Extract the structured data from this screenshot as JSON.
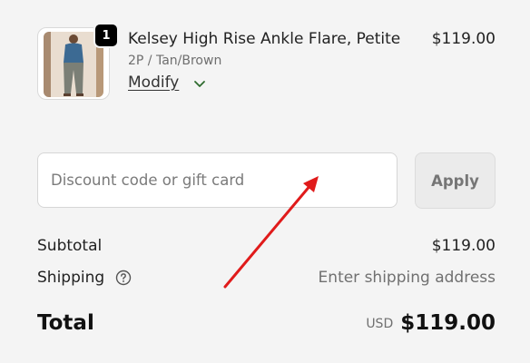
{
  "line_item": {
    "quantity": "1",
    "name": "Kelsey High Rise Ankle Flare, Petite",
    "variant": "2P / Tan/Brown",
    "modify_label": "Modify",
    "price": "$119.00",
    "chevron_icon": "chevron-down-icon"
  },
  "discount": {
    "placeholder": "Discount code or gift card",
    "value": "",
    "apply_label": "Apply"
  },
  "summary": {
    "subtotal_label": "Subtotal",
    "subtotal_value": "$119.00",
    "shipping_label": "Shipping",
    "shipping_help_icon": "question-circle-icon",
    "shipping_value": "Enter shipping address",
    "total_label": "Total",
    "currency": "USD",
    "total_value": "$119.00"
  },
  "colors": {
    "background": "#f4f4f4",
    "chevron": "#2e6b2e",
    "annotation_arrow": "#e01b1b"
  }
}
